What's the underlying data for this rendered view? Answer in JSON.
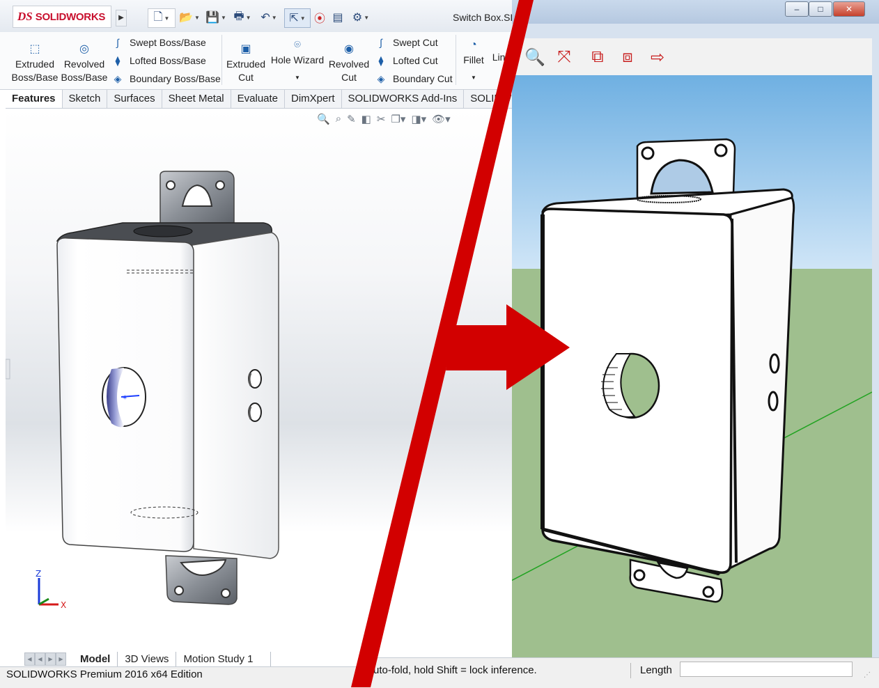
{
  "solidworks": {
    "logo": {
      "ds": "DS",
      "name": "SOLIDWORKS"
    },
    "document_title": "Switch Box.SLD",
    "ribbon": {
      "extruded_boss": {
        "line1": "Extruded",
        "line2": "Boss/Base"
      },
      "revolved_boss": {
        "line1": "Revolved",
        "line2": "Boss/Base"
      },
      "swept_boss": "Swept Boss/Base",
      "lofted_boss": "Lofted Boss/Base",
      "boundary_boss": "Boundary Boss/Base",
      "extruded_cut": {
        "line1": "Extruded",
        "line2": "Cut"
      },
      "hole_wizard": "Hole Wizard",
      "revolved_cut": {
        "line1": "Revolved",
        "line2": "Cut"
      },
      "swept_cut": "Swept Cut",
      "lofted_cut": "Lofted Cut",
      "boundary_cut": "Boundary Cut",
      "fillet": "Fillet",
      "linear": "Line"
    },
    "tabs": [
      "Features",
      "Sketch",
      "Surfaces",
      "Sheet Metal",
      "Evaluate",
      "DimXpert",
      "SOLIDWORKS Add-Ins",
      "SOLIDW"
    ],
    "active_tab": "Features",
    "triad": {
      "z": "Z",
      "x": "X"
    },
    "bottom_tabs": [
      "Model",
      "3D Views",
      "Motion Study 1"
    ],
    "status_text": "SOLIDWORKS Premium 2016 x64 Edition"
  },
  "sketchup": {
    "window_buttons": {
      "minimize": "‒",
      "maximize": "□",
      "close": "✕"
    },
    "status_hint": "Auto-fold, hold Shift = lock inference.",
    "length_label": "Length",
    "length_value": ""
  },
  "colors": {
    "divider_red": "#d20000",
    "sky_top": "#6fb0e2",
    "ground": "#9fbf8e",
    "solidworks_red": "#c8102e"
  }
}
